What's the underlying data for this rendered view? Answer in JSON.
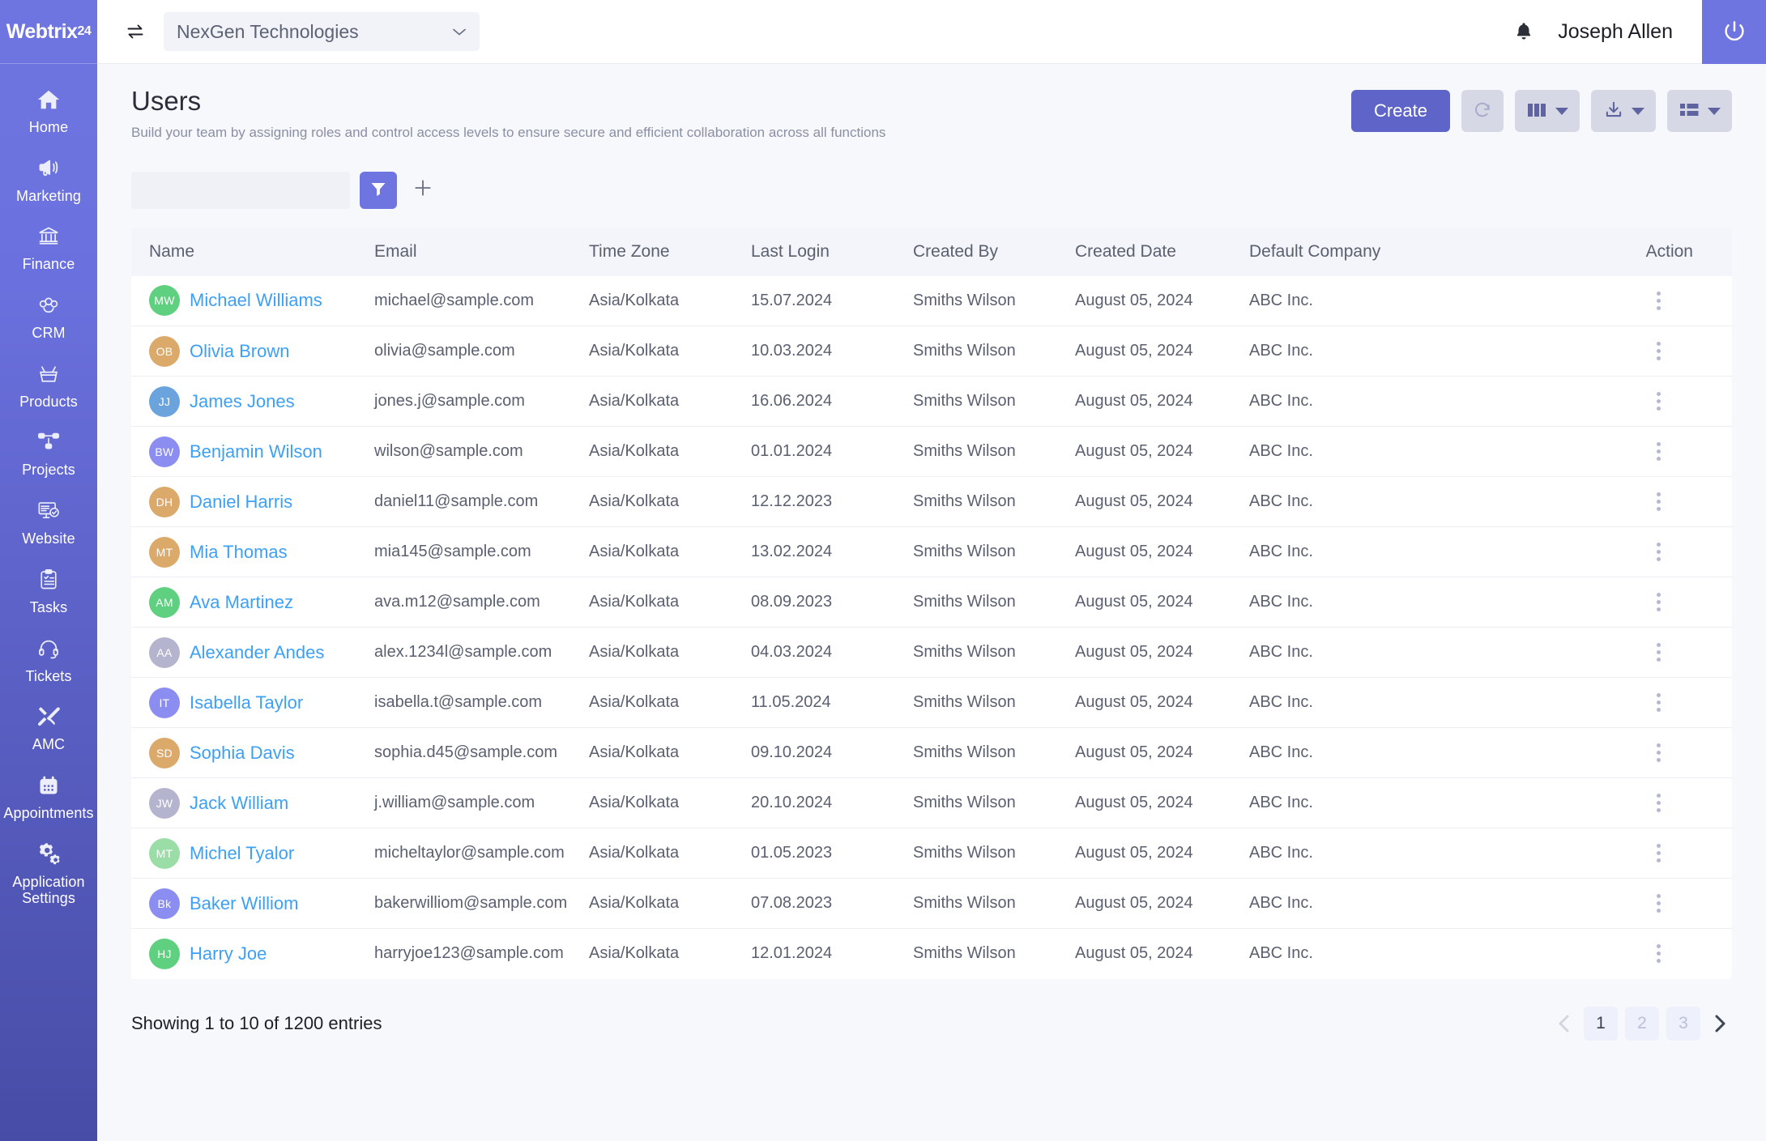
{
  "brand": {
    "name_main": "Webtrix",
    "name_suffix": "24"
  },
  "topbar": {
    "swap_icon": "swap-horizontal-icon",
    "company_selected": "NexGen Technologies",
    "chevron": "chevron-down-icon",
    "bell_icon": "bell-icon",
    "user_name": "Joseph Allen",
    "power_icon": "power-icon"
  },
  "sidebar": {
    "items": [
      {
        "label": "Home",
        "icon": "home-icon"
      },
      {
        "label": "Marketing",
        "icon": "megaphone-icon"
      },
      {
        "label": "Finance",
        "icon": "bank-icon"
      },
      {
        "label": "CRM",
        "icon": "people-icon"
      },
      {
        "label": "Products",
        "icon": "basket-icon"
      },
      {
        "label": "Projects",
        "icon": "sitemap-icon"
      },
      {
        "label": "Website",
        "icon": "monitor-check-icon"
      },
      {
        "label": "Tasks",
        "icon": "clipboard-check-icon"
      },
      {
        "label": "Tickets",
        "icon": "headset-icon"
      },
      {
        "label": "AMC",
        "icon": "tools-icon"
      },
      {
        "label": "Appointments",
        "icon": "calendar-icon"
      },
      {
        "label": "Application Settings",
        "icon": "gears-icon"
      }
    ]
  },
  "page": {
    "title": "Users",
    "subtitle": "Build your team by assigning roles and control access levels to ensure secure and efficient collaboration across all functions"
  },
  "toolbar": {
    "create_label": "Create",
    "refresh_icon": "refresh-icon",
    "columns_icon": "columns-icon",
    "export_icon": "download-icon",
    "view_icon": "list-view-icon"
  },
  "filterbar": {
    "input_value": "",
    "input_placeholder": "",
    "filter_icon": "funnel-icon",
    "add_icon": "plus-icon"
  },
  "table": {
    "columns": [
      "Name",
      "Email",
      "Time Zone",
      "Last Login",
      "Created By",
      "Created Date",
      "Default Company",
      "Action"
    ],
    "rows": [
      {
        "initials": "MW",
        "avatar_color": "#5fd07f",
        "name": "Michael Williams",
        "email": "michael@sample.com",
        "timezone": "Asia/Kolkata",
        "last_login": "15.07.2024",
        "created_by": "Smiths Wilson",
        "created_date": "August 05, 2024",
        "company": "ABC Inc."
      },
      {
        "initials": "OB",
        "avatar_color": "#dba96a",
        "name": "Olivia Brown",
        "email": "olivia@sample.com",
        "timezone": "Asia/Kolkata",
        "last_login": "10.03.2024",
        "created_by": "Smiths Wilson",
        "created_date": "August 05, 2024",
        "company": "ABC Inc."
      },
      {
        "initials": "JJ",
        "avatar_color": "#6ba4dd",
        "name": "James Jones",
        "email": "jones.j@sample.com",
        "timezone": "Asia/Kolkata",
        "last_login": "16.06.2024",
        "created_by": "Smiths Wilson",
        "created_date": "August 05, 2024",
        "company": "ABC Inc."
      },
      {
        "initials": "BW",
        "avatar_color": "#8b8ef0",
        "name": "Benjamin Wilson",
        "email": "wilson@sample.com",
        "timezone": "Asia/Kolkata",
        "last_login": "01.01.2024",
        "created_by": "Smiths Wilson",
        "created_date": "August 05, 2024",
        "company": "ABC Inc."
      },
      {
        "initials": "DH",
        "avatar_color": "#dba96a",
        "name": "Daniel Harris",
        "email": "daniel11@sample.com",
        "timezone": "Asia/Kolkata",
        "last_login": "12.12.2023",
        "created_by": "Smiths Wilson",
        "created_date": "August 05, 2024",
        "company": "ABC Inc."
      },
      {
        "initials": "MT",
        "avatar_color": "#dba96a",
        "name": "Mia Thomas",
        "email": "mia145@sample.com",
        "timezone": "Asia/Kolkata",
        "last_login": "13.02.2024",
        "created_by": "Smiths Wilson",
        "created_date": "August 05, 2024",
        "company": "ABC Inc."
      },
      {
        "initials": "AM",
        "avatar_color": "#5fd07f",
        "name": "Ava Martinez",
        "email": "ava.m12@sample.com",
        "timezone": "Asia/Kolkata",
        "last_login": "08.09.2023",
        "created_by": "Smiths Wilson",
        "created_date": "August 05, 2024",
        "company": "ABC Inc."
      },
      {
        "initials": "AA",
        "avatar_color": "#b5b4ce",
        "name": "Alexander Andes",
        "email": "alex.1234l@sample.com",
        "timezone": "Asia/Kolkata",
        "last_login": "04.03.2024",
        "created_by": "Smiths Wilson",
        "created_date": "August 05, 2024",
        "company": "ABC Inc."
      },
      {
        "initials": "IT",
        "avatar_color": "#8b8ef0",
        "name": "Isabella Taylor",
        "email": "isabella.t@sample.com",
        "timezone": "Asia/Kolkata",
        "last_login": "11.05.2024",
        "created_by": "Smiths Wilson",
        "created_date": "August 05, 2024",
        "company": "ABC Inc."
      },
      {
        "initials": "SD",
        "avatar_color": "#dba96a",
        "name": "Sophia Davis",
        "email": "sophia.d45@sample.com",
        "timezone": "Asia/Kolkata",
        "last_login": "09.10.2024",
        "created_by": "Smiths Wilson",
        "created_date": "August 05, 2024",
        "company": "ABC Inc."
      },
      {
        "initials": "JW",
        "avatar_color": "#b5b4ce",
        "name": "Jack William",
        "email": "j.william@sample.com",
        "timezone": "Asia/Kolkata",
        "last_login": "20.10.2024",
        "created_by": "Smiths Wilson",
        "created_date": "August 05, 2024",
        "company": "ABC Inc."
      },
      {
        "initials": "MT",
        "avatar_color": "#9bdda6",
        "name": "Michel Tyalor",
        "email": "micheltaylor@sample.com",
        "timezone": "Asia/Kolkata",
        "last_login": "01.05.2023",
        "created_by": "Smiths Wilson",
        "created_date": "August 05, 2024",
        "company": "ABC Inc."
      },
      {
        "initials": "Bk",
        "avatar_color": "#8b8ef0",
        "name": "Baker Williom",
        "email": "bakerwilliom@sample.com",
        "timezone": "Asia/Kolkata",
        "last_login": "07.08.2023",
        "created_by": "Smiths Wilson",
        "created_date": "August 05, 2024",
        "company": "ABC Inc."
      },
      {
        "initials": "HJ",
        "avatar_color": "#5fd07f",
        "name": "Harry Joe",
        "email": "harryjoe123@sample.com",
        "timezone": "Asia/Kolkata",
        "last_login": "12.01.2024",
        "created_by": "Smiths Wilson",
        "created_date": "August 05, 2024",
        "company": "ABC Inc."
      }
    ],
    "row_action_icon": "kebab-menu-icon"
  },
  "footer": {
    "entries_text": "Showing 1 to 10 of 1200 entries",
    "prev_icon": "chevron-left-icon",
    "next_icon": "chevron-right-icon",
    "pages": [
      "1",
      "2",
      "3"
    ],
    "active_page": "1"
  },
  "colors": {
    "brand_purple": "#6f75e0",
    "create_button": "#5f64c9",
    "link_blue": "#3da0f5",
    "page_bg": "#f7f8fb"
  }
}
